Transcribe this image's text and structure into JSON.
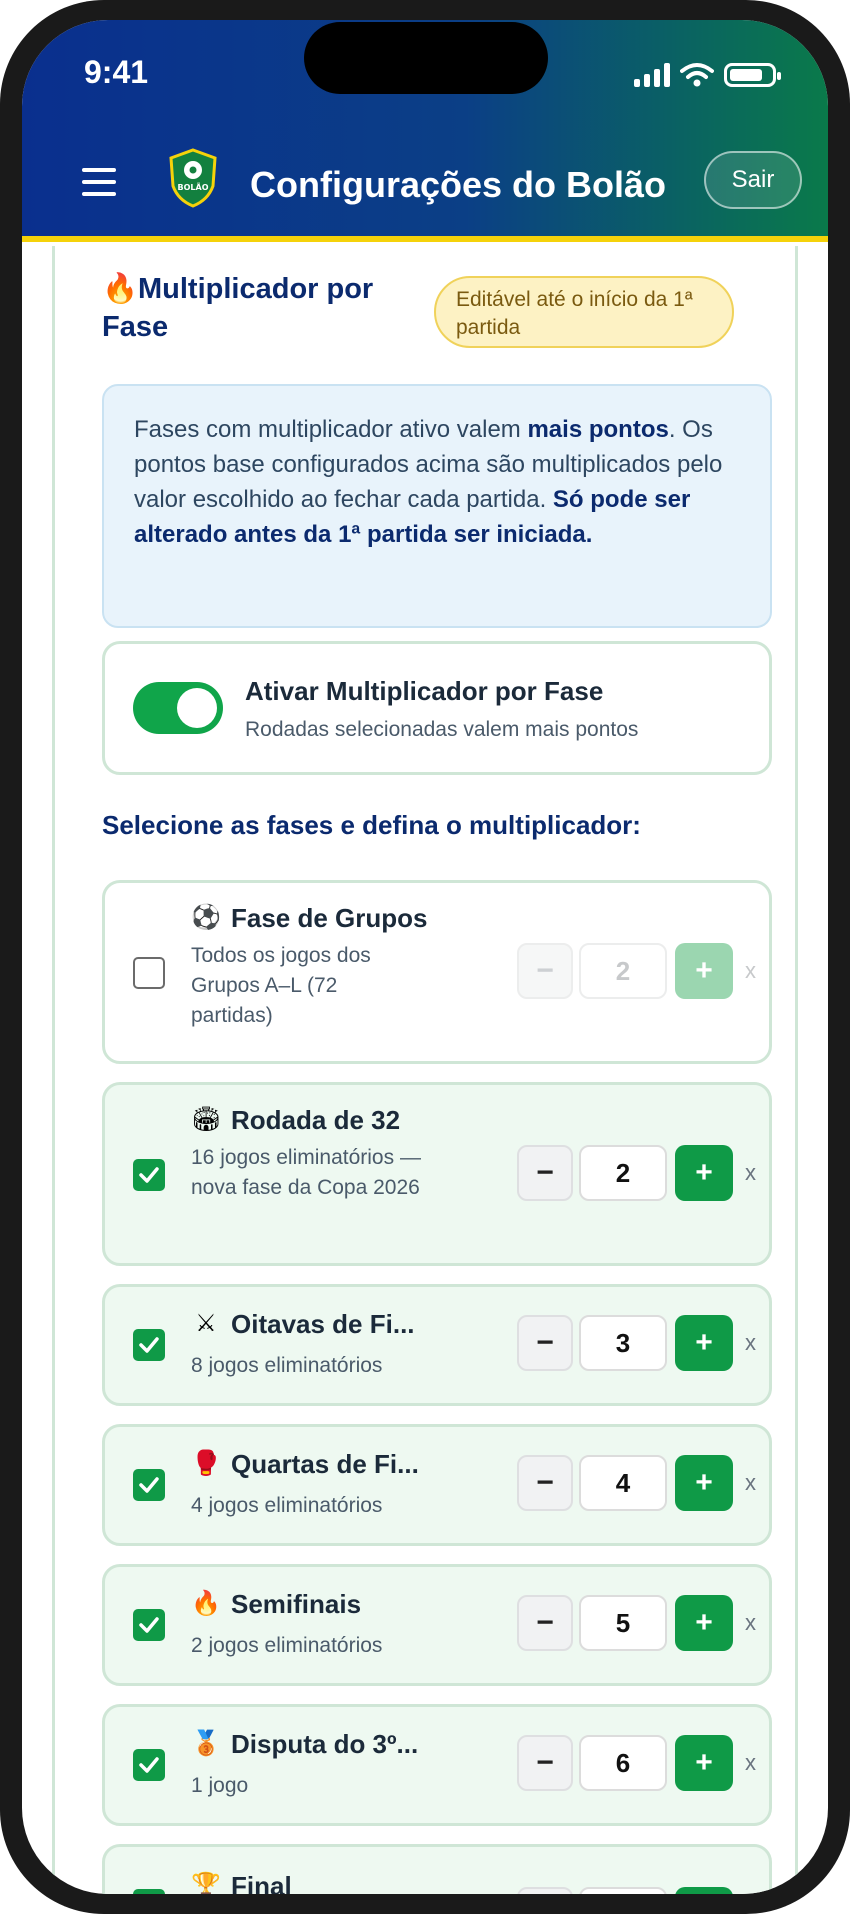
{
  "status": {
    "time": "9:41"
  },
  "header": {
    "title": "Configurações do Bolão",
    "logout": "Sair",
    "logo_text": "BOLÃO"
  },
  "section": {
    "title": "Multiplicador por Fase",
    "badge": "Editável até o início da 1ª partida",
    "info_p1": "Fases com multiplicador ativo valem ",
    "info_b1": "mais pontos",
    "info_p2": ". Os pontos base configurados acima são multiplicados pelo valor escolhido ao fechar cada partida. ",
    "info_b2": "Só pode ser alterado antes da 1ª partida ser iniciada."
  },
  "toggle": {
    "label": "Ativar Multiplicador por Fase",
    "sub": "Rodadas selecionadas valem mais pontos",
    "on": true
  },
  "select_label": "Selecione as fases e defina o multiplicador:",
  "phases": [
    {
      "icon": "⚽",
      "name": "Fase de Grupos",
      "desc": "Todos os jogos dos Grupos A–L (72 partidas)",
      "value": "2",
      "checked": false
    },
    {
      "icon": "🏟",
      "name": "Rodada de 32",
      "desc": "16 jogos eliminatórios — nova fase da Copa 2026",
      "value": "2",
      "checked": true
    },
    {
      "icon": "⚔",
      "name": "Oitavas de Fi...",
      "desc": "8 jogos eliminatórios",
      "value": "3",
      "checked": true
    },
    {
      "icon": "🥊",
      "name": "Quartas de Fi...",
      "desc": "4 jogos eliminatórios",
      "value": "4",
      "checked": true
    },
    {
      "icon": "🔥",
      "name": "Semifinais",
      "desc": "2 jogos eliminatórios",
      "value": "5",
      "checked": true
    },
    {
      "icon": "🥉",
      "name": "Disputa do 3º...",
      "desc": "1 jogo",
      "value": "6",
      "checked": true
    },
    {
      "icon": "🏆",
      "name": "Final",
      "desc": "",
      "value": "",
      "checked": true
    }
  ],
  "stepper": {
    "minus": "−",
    "plus": "+",
    "suffix": "x"
  },
  "colors": {
    "primary": "#0b2a6e",
    "accent_green": "#0f9a47",
    "header_yellow": "#f5d20a"
  }
}
